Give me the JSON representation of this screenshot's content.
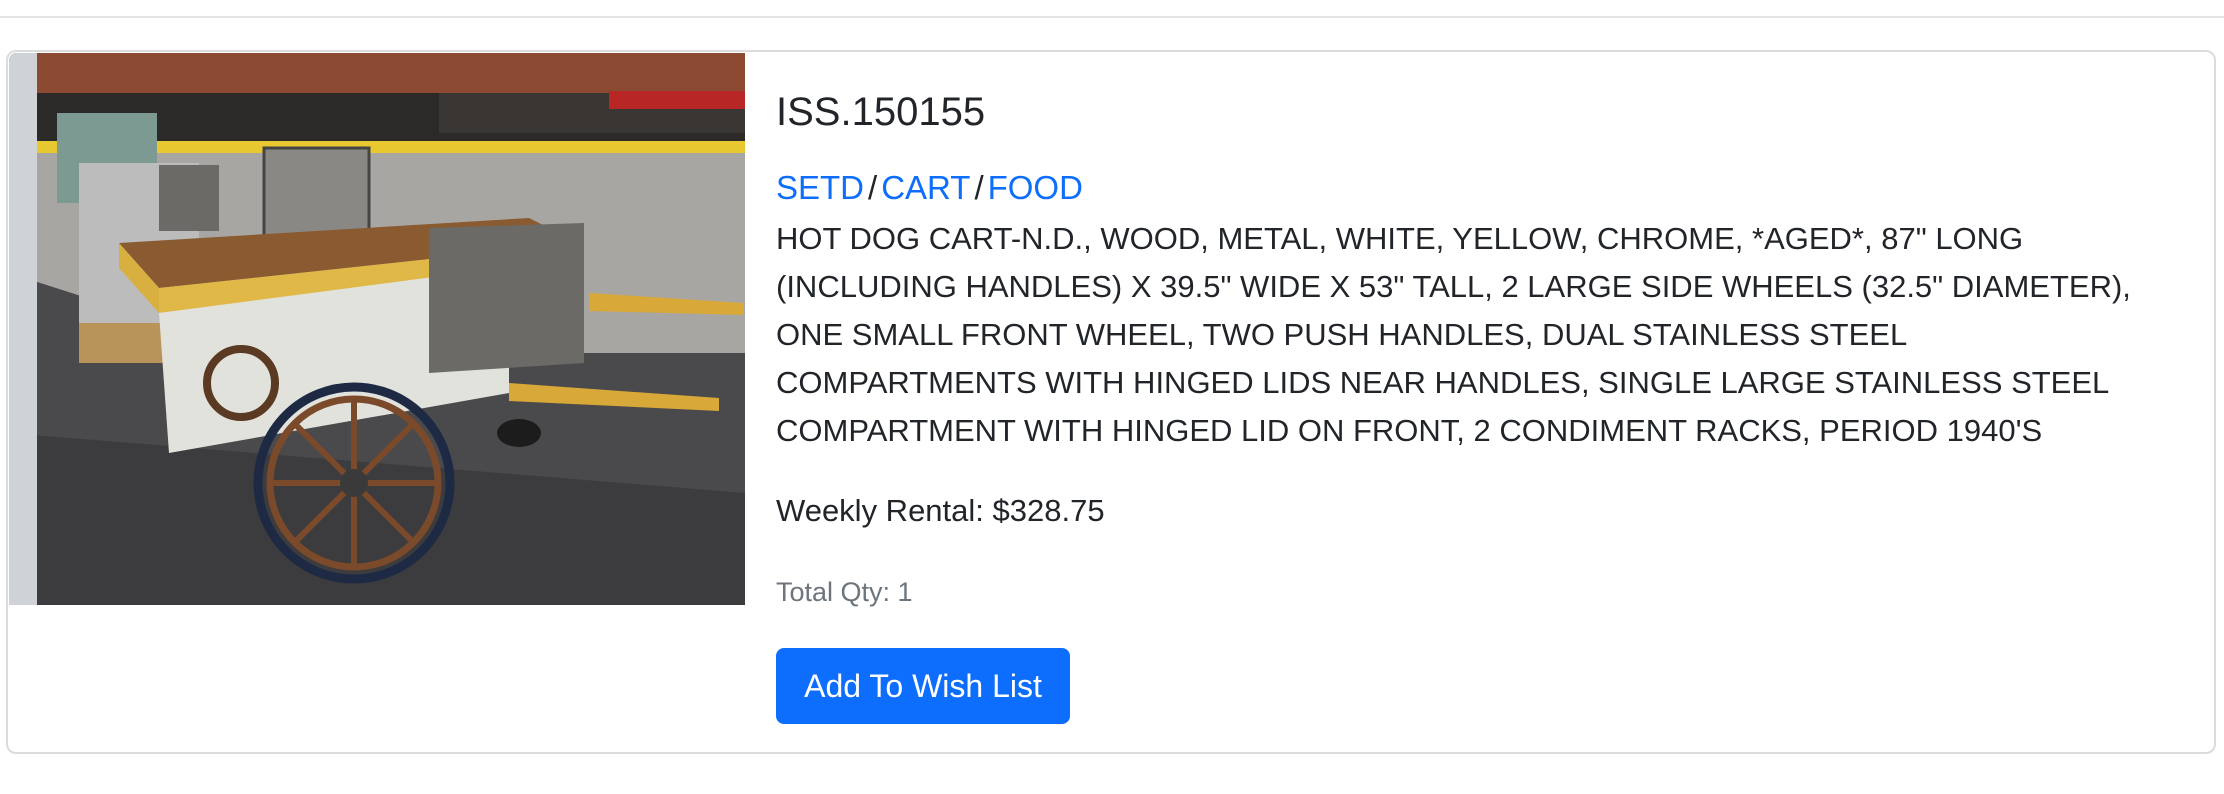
{
  "item": {
    "id": "ISS.150155",
    "breadcrumb": {
      "level1": "SETD",
      "level2": "CART",
      "level3": "FOOD",
      "separator": "/"
    },
    "description": "HOT DOG CART-N.D., WOOD, METAL, WHITE, YELLOW, CHROME, *AGED*, 87\" LONG (INCLUDING HANDLES) X 39.5\" WIDE X 53\" TALL, 2 LARGE SIDE WHEELS (32.5\" DIAMETER), ONE SMALL FRONT WHEEL, TWO PUSH HANDLES, DUAL STAINLESS STEEL COMPARTMENTS WITH HINGED LIDS NEAR HANDLES, SINGLE LARGE STAINLESS STEEL COMPARTMENT WITH HINGED LID ON FRONT, 2 CONDIMENT RACKS, PERIOD 1940'S",
    "weekly_rental": "Weekly Rental: $328.75",
    "total_qty": "Total Qty: 1",
    "wish_button_label": "Add To Wish List"
  },
  "colors": {
    "link": "#0d6efd",
    "button": "#0d6efd",
    "muted_text": "#6c757d",
    "card_border": "#dcdcdc"
  }
}
